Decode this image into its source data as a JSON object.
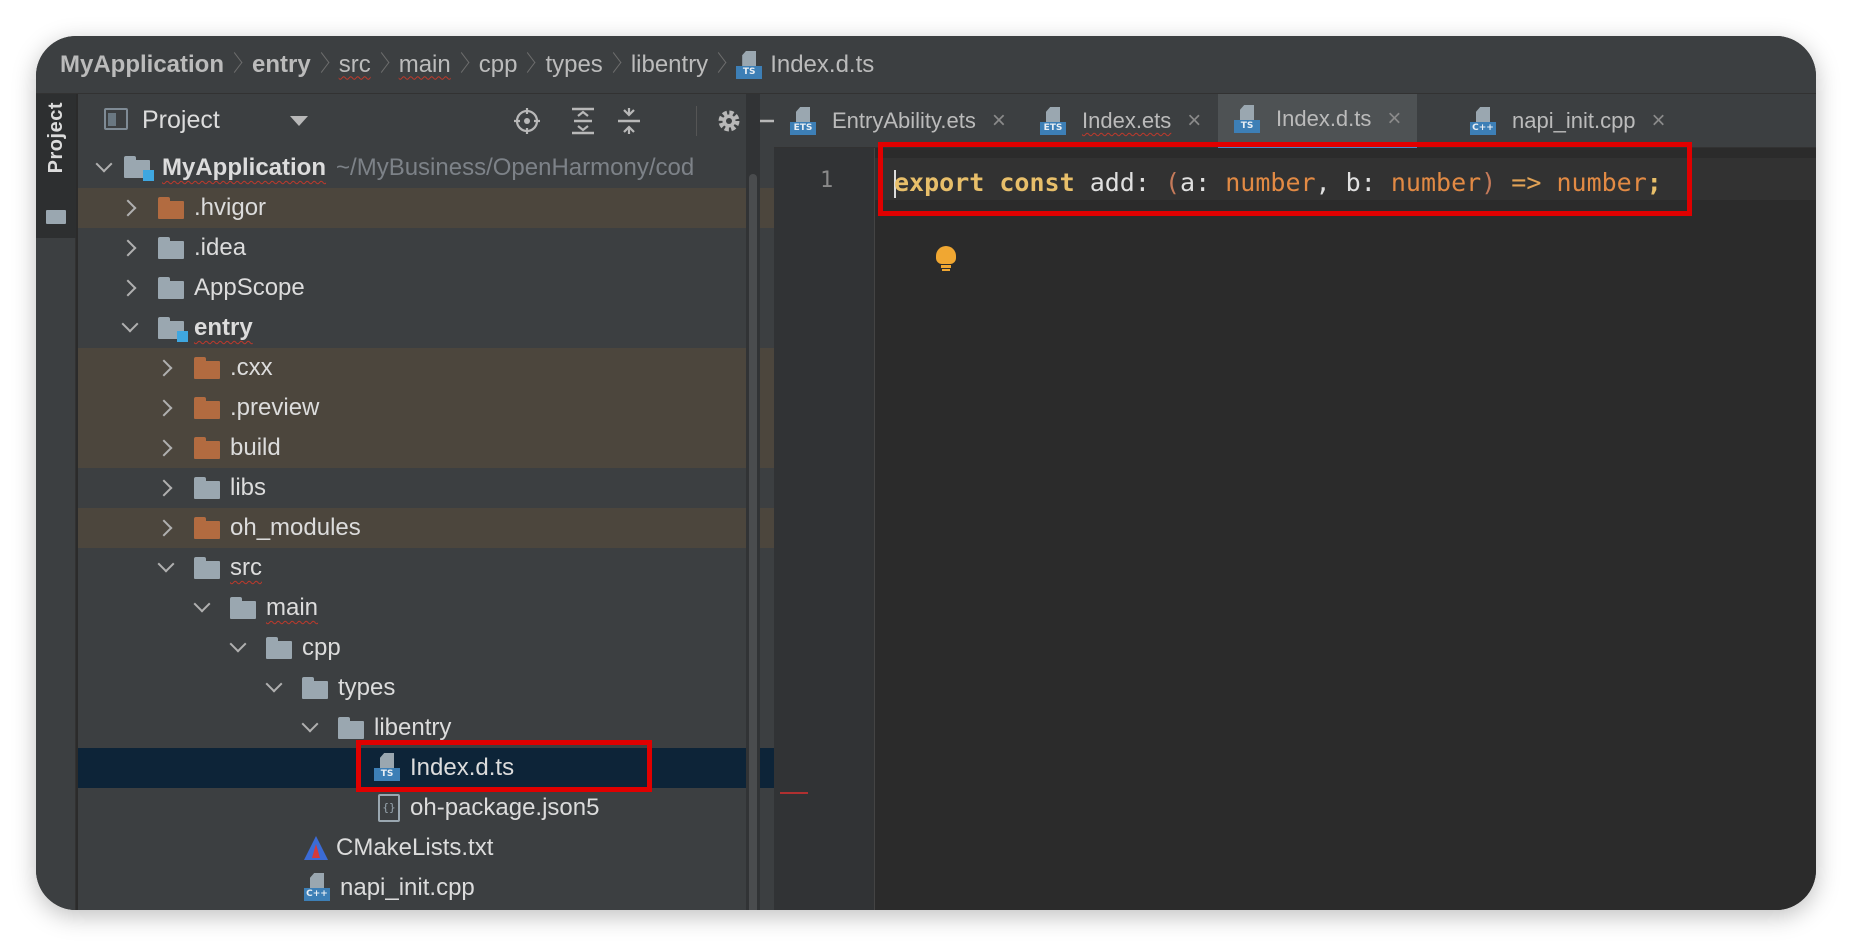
{
  "breadcrumb": {
    "items": [
      {
        "label": "MyApplication"
      },
      {
        "label": "entry"
      },
      {
        "label": "src"
      },
      {
        "label": "main"
      },
      {
        "label": "cpp"
      },
      {
        "label": "types"
      },
      {
        "label": "libentry"
      },
      {
        "label": "Index.d.ts",
        "icon": "typescript-file-icon"
      }
    ]
  },
  "stripe": {
    "project_tab_label": "Project"
  },
  "project_panel": {
    "title": "Project",
    "toolbar": [
      "locate-icon",
      "expand-all-icon",
      "collapse-all-icon",
      "gear-icon",
      "minimize-icon"
    ]
  },
  "tree": {
    "root": {
      "label": "MyApplication",
      "path": "~/MyBusiness/OpenHarmony/cod"
    },
    "items": [
      {
        "label": ".hvigor"
      },
      {
        "label": ".idea"
      },
      {
        "label": "AppScope"
      },
      {
        "label": "entry"
      },
      {
        "label": ".cxx"
      },
      {
        "label": ".preview"
      },
      {
        "label": "build"
      },
      {
        "label": "libs"
      },
      {
        "label": "oh_modules"
      },
      {
        "label": "src"
      },
      {
        "label": "main"
      },
      {
        "label": "cpp"
      },
      {
        "label": "types"
      },
      {
        "label": "libentry"
      },
      {
        "label": "Index.d.ts"
      },
      {
        "label": "oh-package.json5"
      },
      {
        "label": "CMakeLists.txt"
      },
      {
        "label": "napi_init.cpp"
      }
    ]
  },
  "file_icon_tags": {
    "ts": "TS",
    "ets": "ETS",
    "cpp": "C++",
    "json": "{}"
  },
  "editor": {
    "tabs": [
      {
        "label": "EntryAbility.ets",
        "icon": "ets-file-icon"
      },
      {
        "label": "Index.ets",
        "icon": "ets-file-icon"
      },
      {
        "label": "Index.d.ts",
        "icon": "typescript-file-icon",
        "active": true
      },
      {
        "label": "napi_init.cpp",
        "icon": "cpp-file-icon"
      }
    ],
    "close_glyph": "×",
    "line_number": "1",
    "code": {
      "export": "export",
      "const": "const",
      "name": "add",
      "colon1": ":",
      "paren_open": "(",
      "a": "a",
      "colon2": ":",
      "type1": "number",
      "comma": ",",
      "b": "b",
      "colon3": ":",
      "type2": "number",
      "paren_close": ")",
      "arrow": "=>",
      "type3": "number",
      "semi": ";"
    }
  },
  "colors": {
    "annotation_red": "#e00000",
    "keyword": "#e8bf6a",
    "type": "#e28a44",
    "selection": "#0d2438",
    "excluded_folder": "#b26b40"
  }
}
